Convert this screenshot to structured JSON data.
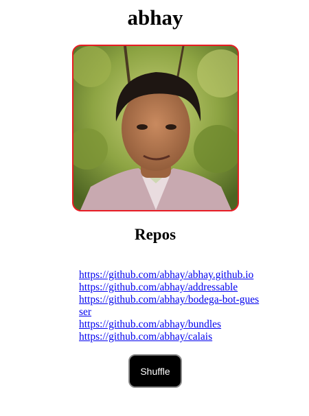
{
  "profile": {
    "username": "abhay",
    "avatar_alt": "abhay"
  },
  "repos": {
    "heading": "Repos",
    "items": [
      {
        "label": "https://github.com/abhay/abhay.github.io"
      },
      {
        "label": "https://github.com/abhay/addressable"
      },
      {
        "label": "https://github.com/abhay/bodega-bot-guesser"
      },
      {
        "label": "https://github.com/abhay/bundles"
      },
      {
        "label": "https://github.com/abhay/calais"
      }
    ]
  },
  "actions": {
    "shuffle_label": "Shuffle"
  },
  "colors": {
    "avatar_border": "#e81b23",
    "link": "#0000ee",
    "button_bg": "#000000",
    "button_text": "#ffffff"
  },
  "icons": {
    "avatar": "profile-photo"
  }
}
